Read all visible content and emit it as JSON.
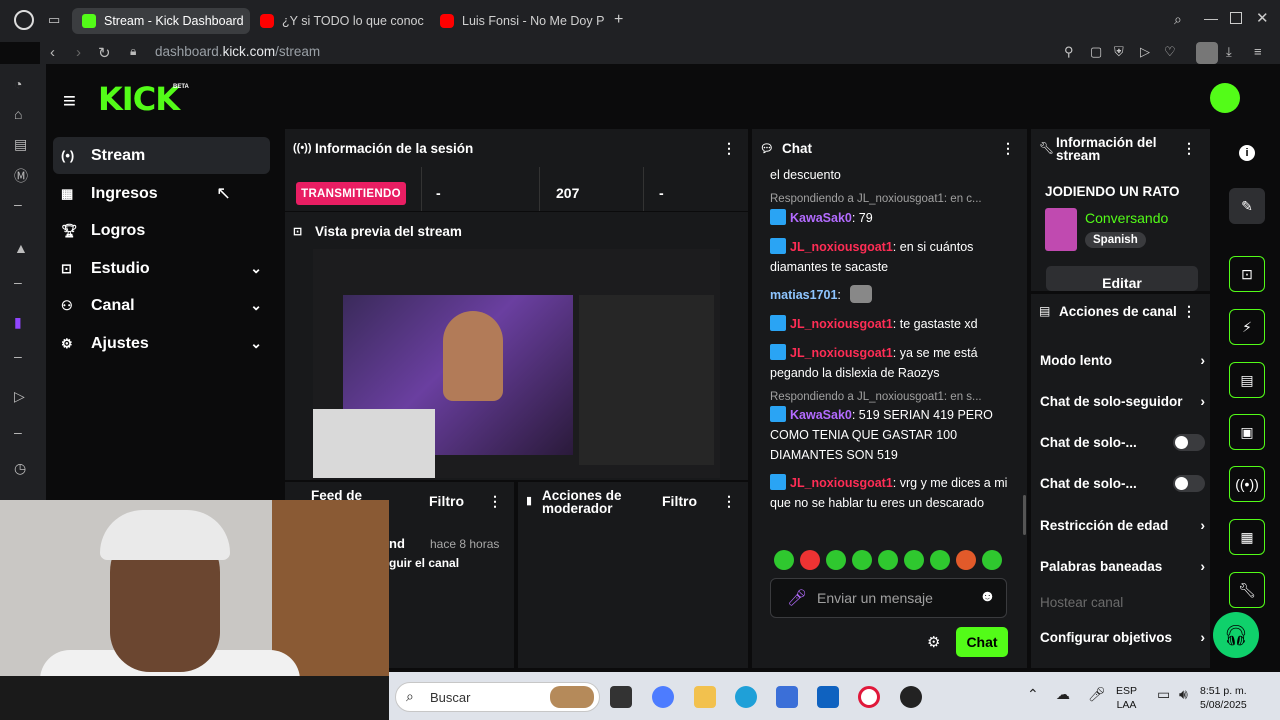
{
  "browser": {
    "tabs": [
      {
        "label": "Stream - Kick Dashboard",
        "icon": "kick-icon",
        "active": true
      },
      {
        "label": "¿Y si TODO lo que conoc",
        "icon": "youtube-icon",
        "active": false
      },
      {
        "label": "Luis Fonsi - No Me Doy P",
        "icon": "youtube-icon",
        "active": false
      }
    ],
    "url_prefix": "dashboard.",
    "url_domain": "kick.com",
    "url_path": "/stream"
  },
  "sidebar": {
    "items": [
      {
        "label": "Stream",
        "icon": "broadcast-icon"
      },
      {
        "label": "Ingresos",
        "icon": "calculator-icon"
      },
      {
        "label": "Logros",
        "icon": "trophy-icon"
      },
      {
        "label": "Estudio",
        "icon": "studio-icon"
      },
      {
        "label": "Canal",
        "icon": "people-icon"
      },
      {
        "label": "Ajustes",
        "icon": "gear-icon"
      }
    ]
  },
  "logo": {
    "text": "KICK",
    "beta": "BETA"
  },
  "session": {
    "title": "Información de la sesión",
    "status": "TRANSMITIENDO",
    "stat1": "-",
    "stat2": "207",
    "stat3": "-"
  },
  "preview": {
    "title": "Vista previa del stream"
  },
  "feed": {
    "title": "Feed de",
    "filter": "Filtro",
    "time": "hace 8 horas",
    "name_fragment": "nd",
    "action_fragment": "guir el canal"
  },
  "mod": {
    "title1": "Acciones de",
    "title2": "moderador",
    "filter": "Filtro"
  },
  "chat": {
    "title": "Chat",
    "top_fragment": "el descuento",
    "messages": [
      {
        "reply": "Respondiendo a JL_noxiousgoat1: en c...",
        "user": "KawaSak0",
        "text": ": 79"
      },
      {
        "reply": "",
        "user": "JL_noxiousgoat1",
        "text": ": en si cuántos diamantes te sacaste"
      },
      {
        "reply": "",
        "user": "matias1701",
        "text": ":"
      },
      {
        "reply": "",
        "user": "JL_noxiousgoat1",
        "text": ": te gastaste xd"
      },
      {
        "reply": "",
        "user": "JL_noxiousgoat1",
        "text": ": ya se me está pegando la dislexia de Raozys"
      },
      {
        "reply": "Respondiendo a JL_noxiousgoat1: en s...",
        "user": "KawaSak0",
        "text": ": 519 SERIAN 419 PERO COMO TENIA QUE GASTAR 100 DIAMANTES SON 519"
      },
      {
        "reply": "",
        "user": "JL_noxiousgoat1",
        "text": ": vrg y me dices a mi que no se hablar tu eres un descarado"
      }
    ],
    "input_placeholder": "Enviar un mensaje",
    "send_label": "Chat",
    "colors": {
      "kawa": "#b36bff",
      "jl": "#ff2d55",
      "matias": "#8ec5ff"
    }
  },
  "streaminfo": {
    "title1": "Información del",
    "title2": "stream",
    "stream_title": "JODIENDO UN RATO",
    "category": "Conversando",
    "language": "Spanish",
    "edit_label": "Editar"
  },
  "actions": {
    "title": "Acciones de canal",
    "items": [
      {
        "label": "Modo lento",
        "control": "arrow"
      },
      {
        "label": "Chat de solo-seguidor",
        "control": "arrow"
      },
      {
        "label": "Chat de solo-...",
        "control": "toggle"
      },
      {
        "label": "Chat de solo-...",
        "control": "toggle"
      },
      {
        "label": "Restricción de edad",
        "control": "arrow"
      },
      {
        "label": "Palabras baneadas",
        "control": "arrow"
      },
      {
        "label": "Hostear canal",
        "control": "none"
      },
      {
        "label": "Configurar objetivos",
        "control": "arrow"
      }
    ]
  },
  "taskbar": {
    "search_placeholder": "Buscar",
    "lang1": "ESP",
    "lang2": "LAA",
    "time": "8:51 p. m.",
    "date": "5/08/2025"
  },
  "colors": {
    "accent": "#53fc18",
    "live": "#e91e63",
    "panel": "#18191b"
  }
}
